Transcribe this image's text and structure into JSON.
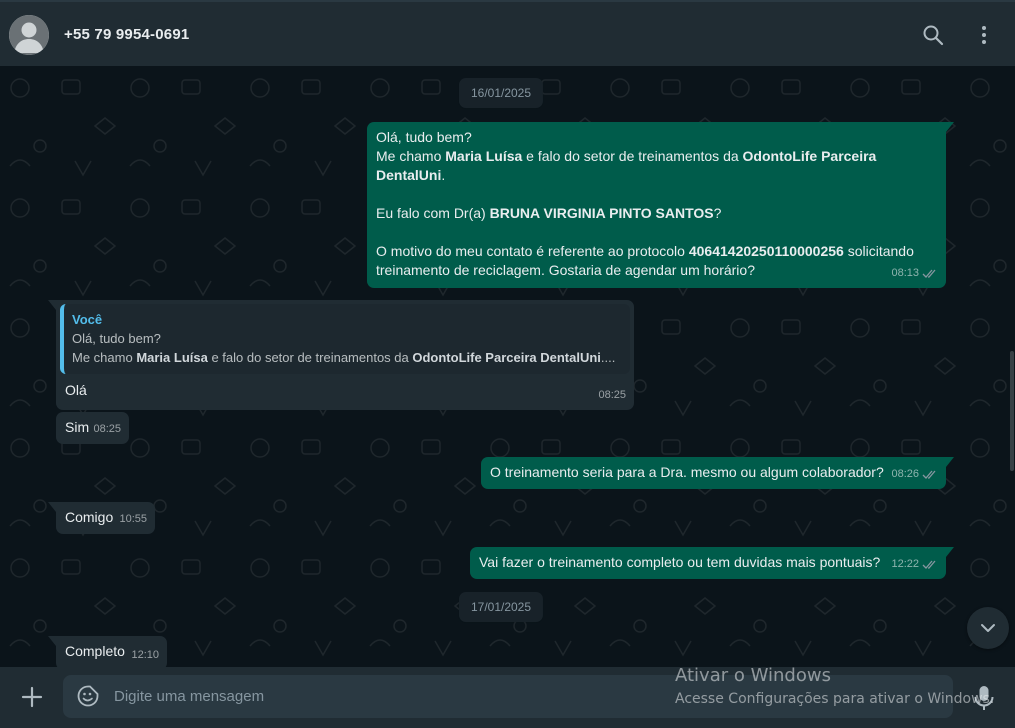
{
  "header": {
    "contact_name": "+55 79 9954-0691",
    "icons": [
      "avatar-icon",
      "search-icon",
      "menu-icon"
    ]
  },
  "chat": {
    "date_1": "16/01/2025",
    "date_2": "17/01/2025",
    "msg1": {
      "line1": "Olá, tudo bem?",
      "line2_pre": "Me chamo ",
      "line2_name": "Maria Luísa",
      "line2_mid": " e falo do setor de treinamentos da ",
      "line2_company": "OdontoLife Parceira DentalUni",
      "line2_end": ".",
      "line3_pre": "Eu falo com Dr(a) ",
      "line3_name": "BRUNA VIRGINIA PINTO SANTOS",
      "line3_end": "?",
      "line4_pre": "O motivo do meu contato é referente ao protocolo ",
      "line4_protocol": "40641420250110000256",
      "line4_end": " solicitando treinamento de reciclagem. Gostaria de agendar um horário?",
      "time": "08:13"
    },
    "msg2": {
      "quote_author": "Você",
      "quote_line1": "Olá, tudo bem?",
      "quote_line2_pre": "Me chamo ",
      "quote_line2_name": "Maria Luísa",
      "quote_line2_mid": " e falo do setor de treinamentos da ",
      "quote_line2_company": "OdontoLife Parceira DentalUni",
      "quote_line2_end": "....",
      "text": "Olá",
      "time": "08:25"
    },
    "msg3": {
      "text": "Sim",
      "time": "08:25"
    },
    "msg4": {
      "text": "O treinamento seria para a Dra. mesmo ou algum colaborador?",
      "time": "08:26"
    },
    "msg5": {
      "text": "Comigo",
      "time": "10:55"
    },
    "msg6": {
      "text": "Vai fazer o treinamento completo ou tem duvidas mais pontuais?",
      "time": "12:22"
    },
    "msg7": {
      "text": "Completo",
      "time": "12:10"
    }
  },
  "footer": {
    "placeholder": "Digite uma mensagem"
  },
  "watermark": {
    "title": "Ativar o Windows",
    "subtitle": "Acesse Configurações para ativar o Windows."
  },
  "colors": {
    "outgoing_bubble": "#005c4b",
    "incoming_bubble": "#202c33",
    "background": "#0b141a",
    "panel": "#202c33",
    "read_ticks": "#8696a0",
    "quote_accent": "#53bdeb"
  }
}
